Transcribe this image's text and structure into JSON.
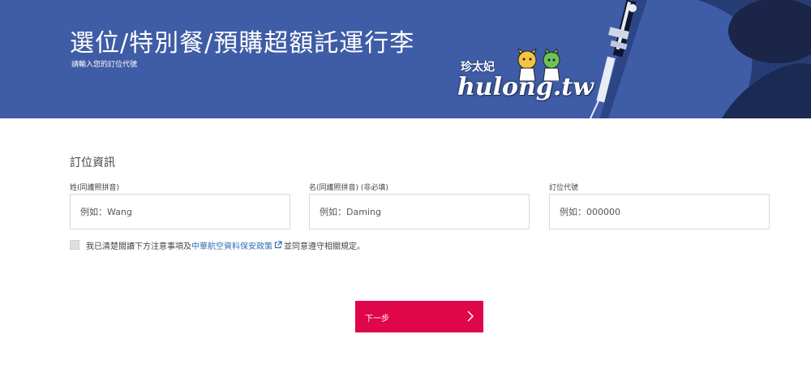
{
  "hero": {
    "title": "選位/特別餐/預購超額託運行李",
    "subtitle": "請輸入您的訂位代號"
  },
  "watermark": {
    "cn": "珍太妃",
    "text": "hulong.tw"
  },
  "form": {
    "section_title": "訂位資訊",
    "fields": [
      {
        "label": "姓(同護照拼音)",
        "placeholder": "例如：Wang"
      },
      {
        "label": "名(同護照拼音) (非必填)",
        "placeholder": "例如：Daming"
      },
      {
        "label": "訂位代號",
        "placeholder": "例如：000000"
      }
    ],
    "consent": {
      "checked": false,
      "prefix": "我已清楚閱讀下方注意事項及",
      "link": "中華航空資料保安政策",
      "suffix": "並同意遵守相關規定。"
    }
  },
  "actions": {
    "next_label": "下一步"
  },
  "colors": {
    "hero_bg": "#3f5ca6",
    "primary_button": "#e0064a",
    "link": "#2f6fb3"
  }
}
